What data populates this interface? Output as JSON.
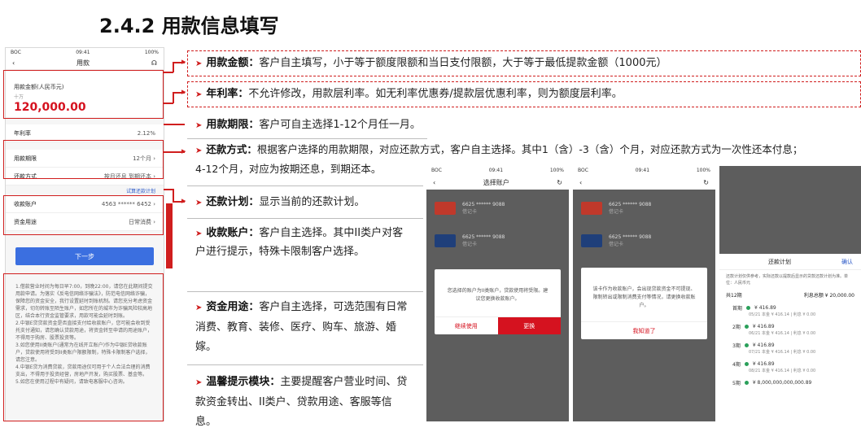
{
  "title": "2.4.2 用款信息填写",
  "phone": {
    "status_left": "BOC",
    "status_time": "09:41",
    "status_right": "100%",
    "back_icon": "chevron-left-icon",
    "nav_title": "用款",
    "help_icon": "headset-icon",
    "amount_label": "用款金额(人民币元)",
    "amount_unit": "十万",
    "amount_value": "120,000.00",
    "rate_label": "年利率",
    "rate_value": "2.12%",
    "term_label": "用款期限",
    "term_value": "12个月 ›",
    "method_label": "还款方式",
    "method_value": "按月还息  到期还本 ›",
    "plan_link": "试算还款计划",
    "account_label": "收款账户",
    "account_value": "4563 ****** 6452 ›",
    "purpose_label": "资金用途",
    "purpose_value": "日常消费 ›",
    "next_button": "下一步",
    "tips": [
      "1.借款营业时间为每日早7:00，到晚22:00，请您在此期间提交用款申请。为落实《反电信网络诈骗法》，防范电信网络诈骗，保障您的资金安全，我行设置延时到账机制。请您充分考虑资金需求，切勿转账至陌生账户，如您所在的城市为诈骗风险较高地区，结合本行资金监管要求，用款可能会延时到账。",
      "2.中银E贷贷款资金是否直接支付给收款账户，您可能会收到受托支付通知，请您确认贷款用途，将资金转至申请的用途账户，不得用于购房、股票投资等。",
      "3.如您使用II类账户(通常为在线开立账户)作为中银E贷收款账户，贷款使用将受到II类账户限额限制，特殊卡限制客户选择，请您注意。",
      "4.中银E贷为消费贷款，贷款用途仅可用于个人合法合理的消费支出，不得用于投资经营，房地产开发，购买股票、基金等。",
      "5.如您在使用过程中有疑问，请致电客服中心咨询。"
    ]
  },
  "annotations": [
    {
      "label": "用款金额：",
      "text": "客户自主填写，小于等于额度限额和当日支付限额，大于等于最低提款金额（1000元）"
    },
    {
      "label": "年利率：",
      "text": "不允许修改，用款层利率。如无利率优惠券/提款层优惠利率，则为额度层利率。"
    },
    {
      "label": "用款期限：",
      "text": "客户可自主选择1-12个月任一月。"
    },
    {
      "label": "还款方式：",
      "text": "根据客户选择的用款期限，对应还款方式，客户自主选择。其中1（含）-3（含）个月，对应还款方式为一次性还本付息；",
      "text2": "4-12个月，对应为按期还息，到期还本。"
    },
    {
      "label": "还款计划：",
      "text": "显示当前的还款计划。"
    },
    {
      "label": "收款账户：",
      "text": "客户自主选择。其中II类户对客",
      "text2": "户进行提示，特殊卡限制客户选择。"
    },
    {
      "label": "资金用途：",
      "text": "客户自主选择，可选范围有日常",
      "text2": "消费、教育、装修、医疗、购车、旅游、婚",
      "text3": "嫁。"
    },
    {
      "label": "温馨提示模块：",
      "text": "主要提醒客户营业时间、贷",
      "text2": "款资金转出、II类户、贷款用途、客服等信",
      "text3": "息。"
    }
  ],
  "screen1": {
    "nav_title": "选择账户",
    "accounts": [
      {
        "number": "6625 ****** 9088",
        "type": "借记卡"
      },
      {
        "number": "6625 ****** 9088",
        "type": "借记卡"
      }
    ],
    "modal_text": "您选择的账户为II类账户，贷款使用将受限。建议您更换收款账户。",
    "btn_continue": "继续使用",
    "btn_change": "更换"
  },
  "screen2": {
    "accounts": [
      {
        "number": "6625 ****** 9088",
        "type": "借记卡"
      },
      {
        "number": "6625 ****** 9088",
        "type": "借记卡"
      }
    ],
    "modal_text": "该卡作为收款账户，会出现贷款资金不可提现、限制转出或限制消费支付等情况，请更换收款账户。",
    "btn_ok": "我知道了"
  },
  "screen3": {
    "sheet_title": "还款计划",
    "confirm": "确认",
    "note": "还款计划仅供参考，实际还款以提款后显示的贷款还款计划为准。单位：人民币元",
    "total_periods": "共12期",
    "total_label": "利息总额 ¥ 20,000.00",
    "periods": [
      {
        "label": "首期",
        "amount": "¥ 416.89",
        "date": "05/21",
        "detail": "本金 ¥ 416.14 | 利息 ¥ 0.00"
      },
      {
        "label": "2期",
        "amount": "¥ 416.89",
        "date": "06/21",
        "detail": "本金 ¥ 416.14 | 利息 ¥ 0.00"
      },
      {
        "label": "3期",
        "amount": "¥ 416.89",
        "date": "07/21",
        "detail": "本金 ¥ 416.14 | 利息 ¥ 0.00"
      },
      {
        "label": "4期",
        "amount": "¥ 416.89",
        "date": "08/21",
        "detail": "本金 ¥ 416.14 | 利息 ¥ 0.00"
      },
      {
        "label": "5期",
        "amount": "¥ 8,000,000,000,000.89",
        "date": "",
        "detail": ""
      }
    ]
  },
  "colors": {
    "accent_red": "#d01e1e",
    "brand_red": "#d5121f",
    "button_blue": "#3b6fe0",
    "sheet_green": "#2aa05a"
  }
}
